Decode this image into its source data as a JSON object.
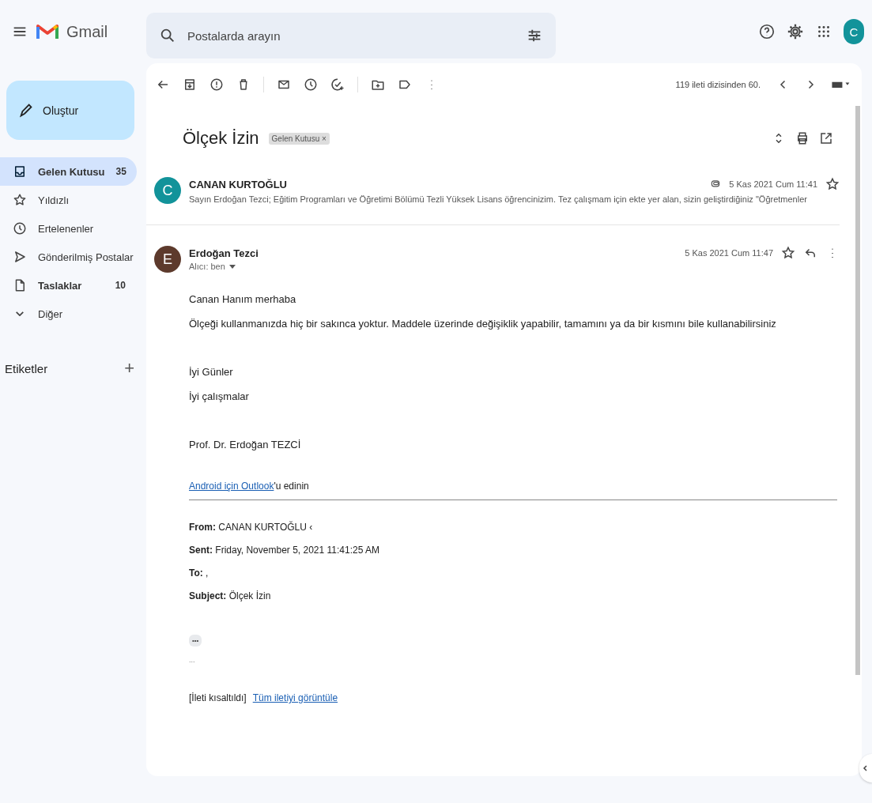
{
  "header": {
    "app_name": "Gmail",
    "search_placeholder": "Postalarda arayın",
    "avatar_letter": "C"
  },
  "sidebar": {
    "compose": "Oluştur",
    "items": [
      {
        "label": "Gelen Kutusu",
        "count": "35",
        "selected": true,
        "unread": true
      },
      {
        "label": "Yıldızlı",
        "selected": false,
        "unread": false
      },
      {
        "label": "Ertelenenler",
        "selected": false,
        "unread": false
      },
      {
        "label": "Gönderilmiş Postalar",
        "selected": false,
        "unread": false
      },
      {
        "label": "Taslaklar",
        "count": "10",
        "selected": false,
        "unread": true
      },
      {
        "label": "Diğer",
        "selected": false,
        "unread": false
      }
    ],
    "labels_heading": "Etiketler",
    "add": "+"
  },
  "toolbar": {
    "counter": "119 ileti dizisinden 60."
  },
  "thread": {
    "subject": "Ölçek İzin",
    "chip": {
      "label": "Gelen Kutusu",
      "remove": "×"
    }
  },
  "collapsed_message": {
    "avatar_letter": "C",
    "sender": "CANAN KURTOĞLU",
    "snippet": "Sayın Erdoğan Tezci; Eğitim Programları ve Öğretimi Bölümü Tezli Yüksek Lisans öğrencinizim. Tez çalışmam için ekte yer alan, sizin geliştirdiğiniz \"Öğretmenler",
    "date": "5 Kas 2021 Cum 11:41",
    "attachment": true,
    "starred": false
  },
  "message": {
    "avatar_letter": "E",
    "sender": "Erdoğan Tezci",
    "recipient": "Alıcı: ben",
    "date": "5 Kas 2021 Cum 11:47",
    "starred": false,
    "body": [
      [
        "Canan Hanım merhaba",
        "Ölçeği kullanmanızda hiç bir sakınca yoktur. Maddele üzerinde değişiklik yapabilir, tamamını ya da bir kısmını bile kullanabilirsiniz"
      ],
      [
        "İyi Günler",
        "İyi çalışmalar"
      ],
      [
        "Prof. Dr. Erdoğan TEZCİ"
      ]
    ],
    "app_line": {
      "link": "Android için Outlook",
      "rest": "'u edinin"
    },
    "quoted": [
      {
        "label": "From:",
        "value": "CANAN KURTOĞLU ‹"
      },
      {
        "label": "Sent:",
        "value": "Friday, November 5, 2021 11:41:25 AM"
      },
      {
        "label": "To:",
        "value": ","
      },
      {
        "label": "Subject:",
        "value": "Ölçek İzin"
      }
    ],
    "more": "•••",
    "ellipsis": "...",
    "trimmed": "[İleti kısaltıldı]",
    "view_all": "Tüm iletiyi görüntüle"
  }
}
